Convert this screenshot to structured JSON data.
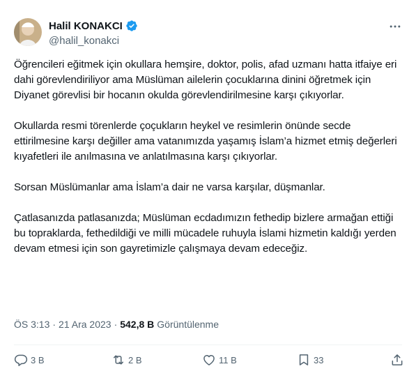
{
  "author": {
    "display_name": "Halil KONAKCI",
    "handle": "@halil_konakci"
  },
  "body": {
    "paragraphs": [
      "Öğrencileri eğitmek için okullara hemşire, doktor, polis, afad uzmanı hatta itfaiye eri dahi görevlendiriliyor ama Müslüman ailelerin çocuklarına dinini öğretmek için Diyanet görevlisi bir hocanın okulda görevlendirilmesine karşı çıkıyorlar.",
      "Okullarda resmi törenlerde çoçukların heykel ve resimlerin önünde secde ettirilmesine karşı değiller ama vatanımızda yaşamış İslam’a hizmet etmiş değerleri kıyafetleri ile anılmasına ve anlatılmasına karşı çıkıyorlar.",
      "Sorsan Müslümanlar ama İslam’a dair ne varsa karşılar, düşmanlar.",
      "Çatlasanızda patlasanızda; Müslüman ecdadımızın fethedip bizlere armağan ettiği bu topraklarda, fethedildiği ve milli mücadele ruhuyla İslami hizmetin kaldığı yerden devam etmesi için son gayretimizle çalışmaya devam edeceğiz."
    ]
  },
  "meta": {
    "time": "ÖS 3:13",
    "separator": "·",
    "date": "21 Ara 2023",
    "views_count": "542,8 B",
    "views_label": "Görüntülenme"
  },
  "actions": {
    "replies": "3 B",
    "reposts": "2 B",
    "likes": "11 B",
    "bookmarks": "33"
  },
  "colors": {
    "text": "#0f1419",
    "secondary": "#536471",
    "verified": "#1d9bf0",
    "divider": "#eff3f4"
  },
  "icons": [
    "verified-badge-icon",
    "more-options-icon",
    "reply-icon",
    "repost-icon",
    "like-icon",
    "bookmark-icon",
    "share-icon"
  ]
}
